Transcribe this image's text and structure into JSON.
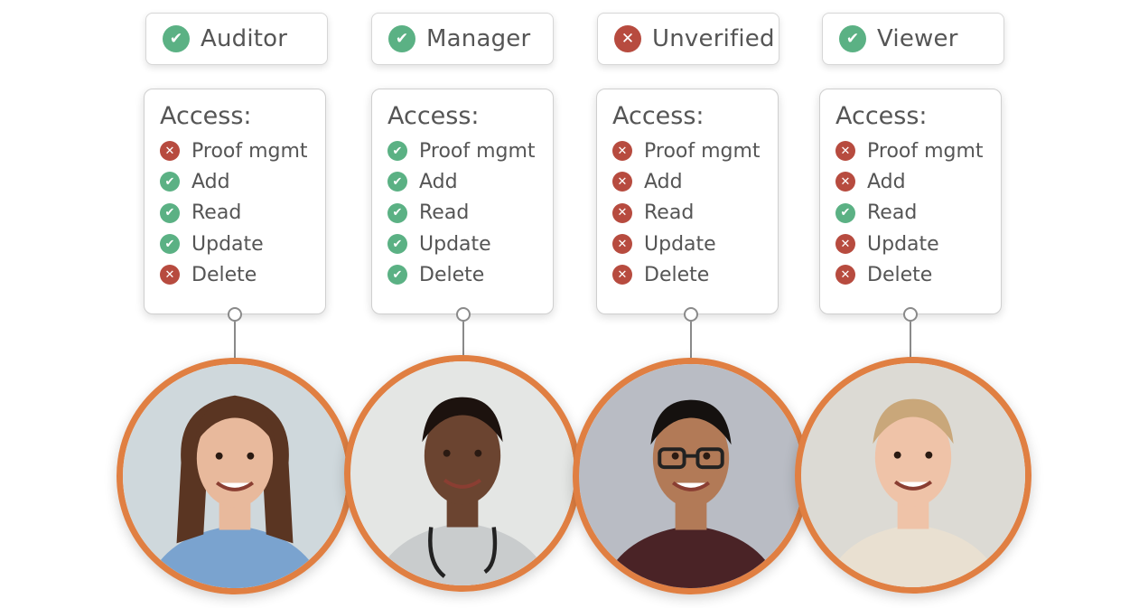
{
  "roles": [
    {
      "name": "Auditor",
      "verified": true,
      "access_title": "Access:",
      "permissions": [
        {
          "label": "Proof mgmt",
          "granted": false
        },
        {
          "label": "Add",
          "granted": true
        },
        {
          "label": "Read",
          "granted": true
        },
        {
          "label": "Update",
          "granted": true
        },
        {
          "label": "Delete",
          "granted": false
        }
      ],
      "avatar": "woman-in-blue-scrubs"
    },
    {
      "name": "Manager",
      "verified": true,
      "access_title": "Access:",
      "permissions": [
        {
          "label": "Proof mgmt",
          "granted": true
        },
        {
          "label": "Add",
          "granted": true
        },
        {
          "label": "Read",
          "granted": true
        },
        {
          "label": "Update",
          "granted": true
        },
        {
          "label": "Delete",
          "granted": true
        }
      ],
      "avatar": "man-with-stethoscope"
    },
    {
      "name": "Unverified",
      "verified": false,
      "access_title": "Access:",
      "permissions": [
        {
          "label": "Proof mgmt",
          "granted": false
        },
        {
          "label": "Add",
          "granted": false
        },
        {
          "label": "Read",
          "granted": false
        },
        {
          "label": "Update",
          "granted": false
        },
        {
          "label": "Delete",
          "granted": false
        }
      ],
      "avatar": "man-with-glasses"
    },
    {
      "name": "Viewer",
      "verified": true,
      "access_title": "Access:",
      "permissions": [
        {
          "label": "Proof mgmt",
          "granted": false
        },
        {
          "label": "Add",
          "granted": false
        },
        {
          "label": "Read",
          "granted": true
        },
        {
          "label": "Update",
          "granted": false
        },
        {
          "label": "Delete",
          "granted": false
        }
      ],
      "avatar": "blond-man-smiling"
    }
  ],
  "icons": {
    "granted": "check-circle-icon",
    "denied": "x-circle-icon",
    "check_glyph": "✔",
    "cross_glyph": "✕"
  },
  "colors": {
    "granted": "#5bb184",
    "denied": "#b74b3f",
    "avatar_ring": "#e07f42",
    "text": "#555555"
  }
}
